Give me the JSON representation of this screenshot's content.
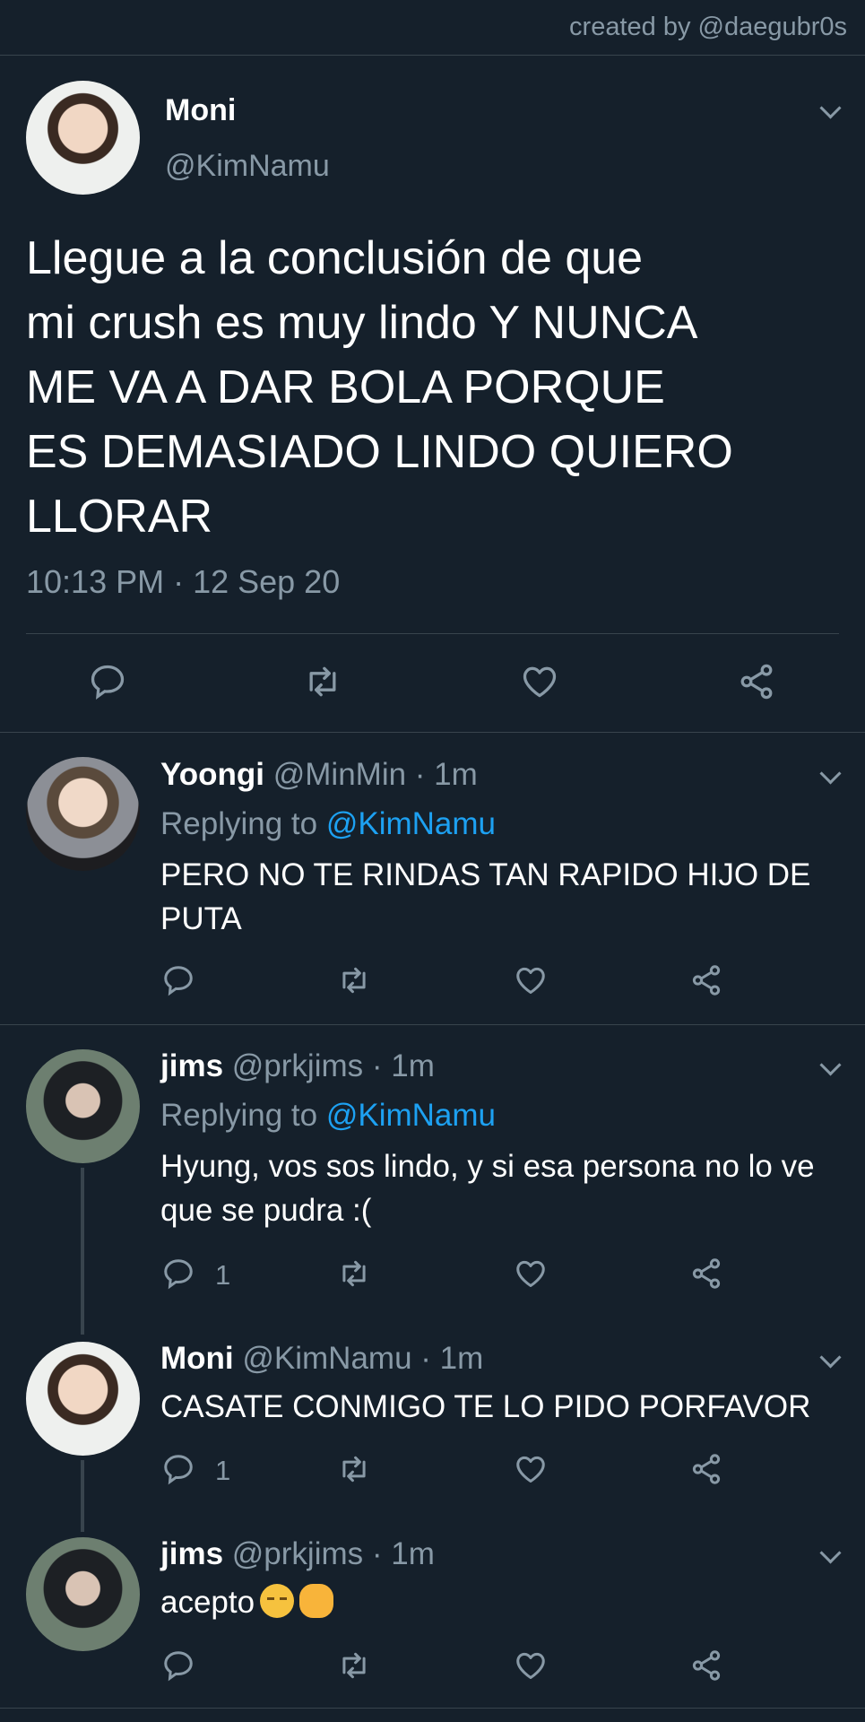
{
  "credit": "created by @daegubr0s",
  "main_tweet": {
    "name": "Moni",
    "handle": "@KimNamu",
    "text": "Llegue a la conclusión de que\nmi crush es muy lindo Y NUNCA\nME VA A DAR BOLA PORQUE\nES DEMASIADO LINDO QUIERO\nLLORAR",
    "timestamp": "10:13 PM · 12 Sep 20"
  },
  "replies": [
    {
      "name": "Yoongi",
      "handle": "@MinMin · 1m",
      "replying_prefix": "Replying to ",
      "replying_to": "@KimNamu",
      "text": "PERO NO TE RINDAS TAN RAPIDO HIJO DE PUTA",
      "reply_count": ""
    },
    {
      "name": "jims",
      "handle": "@prkjims · 1m",
      "replying_prefix": "Replying to ",
      "replying_to": "@KimNamu",
      "text": "Hyung, vos sos lindo, y si esa persona no lo ve que se pudra :(",
      "reply_count": "1"
    },
    {
      "name": "Moni",
      "handle": "@KimNamu · 1m",
      "text": "CASATE CONMIGO TE LO PIDO PORFAVOR",
      "reply_count": "1"
    },
    {
      "name": "jims",
      "handle": "@prkjims · 1m",
      "text": "acepto",
      "emojis": [
        "pensive-face",
        "raised-fist"
      ],
      "reply_count": ""
    }
  ],
  "icons": [
    "reply-icon",
    "retweet-icon",
    "like-icon",
    "share-icon",
    "chevron-down-icon"
  ],
  "colors": {
    "background": "#15202b",
    "secondary_text": "#8899a6",
    "link": "#1da1f2",
    "divider": "#38444d"
  }
}
